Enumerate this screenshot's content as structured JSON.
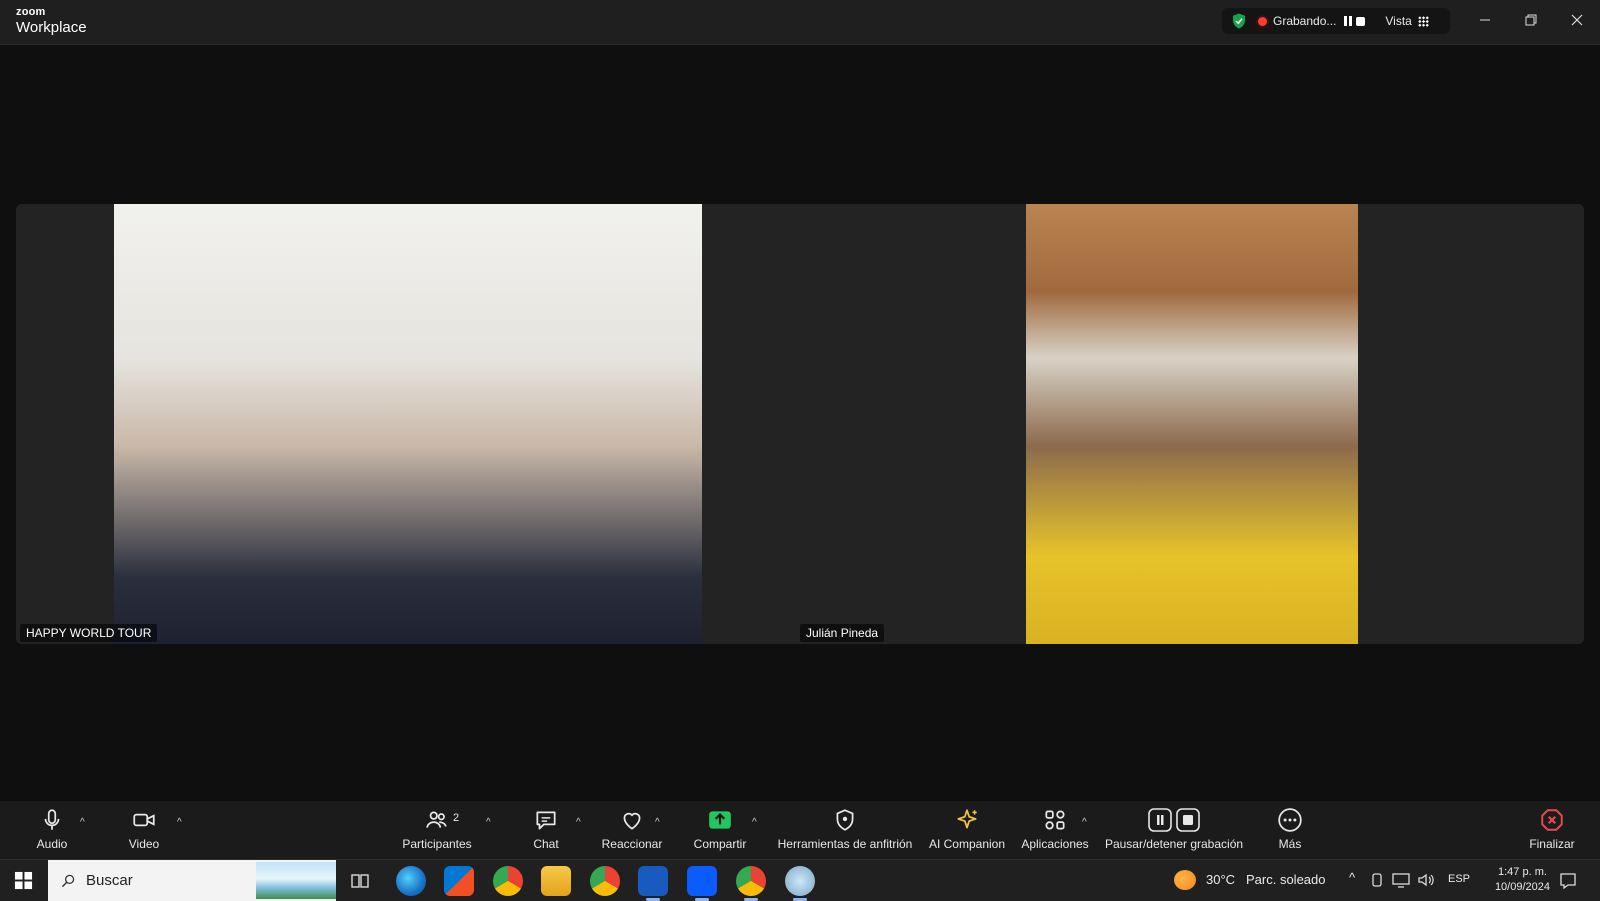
{
  "titlebar": {
    "brand_top": "zoom",
    "brand_bottom": "Workplace",
    "recording_label": "Grabando...",
    "view_label": "Vista"
  },
  "participants": [
    {
      "name": "HAPPY WORLD TOUR"
    },
    {
      "name": "Julián Pineda"
    }
  ],
  "toolbar": {
    "audio": "Audio",
    "video": "Video",
    "participants": "Participantes",
    "participants_count": "2",
    "chat": "Chat",
    "react": "Reaccionar",
    "share": "Compartir",
    "host_tools": "Herramientas de anfitrión",
    "ai_companion": "AI Companion",
    "apps": "Aplicaciones",
    "pause_stop_recording": "Pausar/detener grabación",
    "more": "Más",
    "end": "Finalizar"
  },
  "taskbar": {
    "search_placeholder": "Buscar",
    "weather_temp": "30°C",
    "weather_desc": "Parc. soleado",
    "language": "ESP",
    "time": "1:47 p. m.",
    "date": "10/09/2024"
  },
  "colors": {
    "share_green": "#22c55e",
    "end_red": "#e5484d",
    "recording_red": "#ff3b30",
    "shield_green": "#16a34a"
  }
}
